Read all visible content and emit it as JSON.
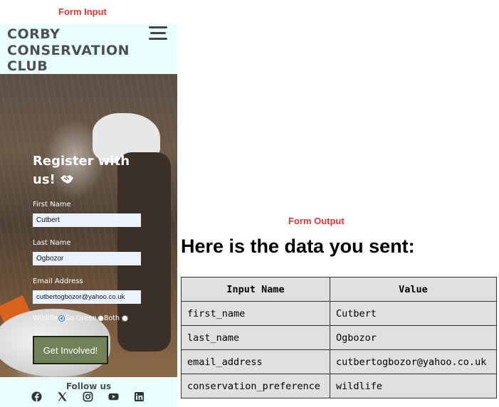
{
  "captions": {
    "input": "Form Input",
    "output": "Form Output"
  },
  "site": {
    "brand_lines": [
      "CORBY",
      "CONSERVATION",
      "CLUB"
    ],
    "menu_icon": "hamburger-menu-icon",
    "form": {
      "title": "Register with us!",
      "title_icon": "handshake-icon",
      "first_name_label": "First Name",
      "first_name_value": "Cutbert",
      "last_name_label": "Last Name",
      "last_name_value": "Ogbozor",
      "email_label": "Email Address",
      "email_value": "cutbertogbozor@yahoo.co.uk",
      "radio_options": [
        {
          "label": "Wildlife",
          "checked": true
        },
        {
          "label": "Go Green",
          "checked": false
        },
        {
          "label": "Both",
          "checked": false
        }
      ],
      "submit_label": "Get Involved!",
      "submit_color": "#71815a"
    },
    "footer": {
      "follow_label": "Follow us",
      "social_icons": [
        "facebook-icon",
        "x-icon",
        "instagram-icon",
        "youtube-icon",
        "linkedin-icon"
      ]
    },
    "header_bg": "#e9ffff"
  },
  "output": {
    "title": "Here is the data you sent:",
    "table": {
      "headers": [
        "Input Name",
        "Value"
      ],
      "rows": [
        [
          "first_name",
          "Cutbert"
        ],
        [
          "last_name",
          "Ogbozor"
        ],
        [
          "email_address",
          "cutbertogbozor@yahoo.co.uk"
        ],
        [
          "conservation_preference",
          "wildlife"
        ]
      ]
    }
  },
  "colors": {
    "caption": "#d9373b",
    "brand_text": "#4f4f4f"
  }
}
